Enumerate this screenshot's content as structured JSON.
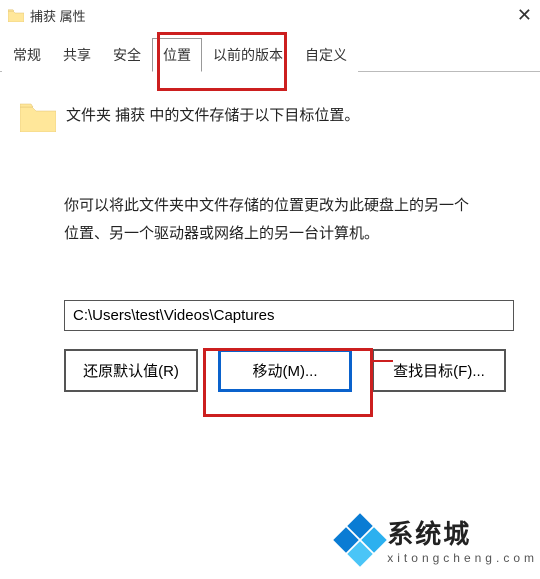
{
  "window": {
    "title": "捕获 属性"
  },
  "tabs": {
    "t0": "常规",
    "t1": "共享",
    "t2": "安全",
    "t3": "位置",
    "t4": "以前的版本",
    "t5": "自定义"
  },
  "content": {
    "line1": "文件夹 捕获 中的文件存储于以下目标位置。",
    "line2": "你可以将此文件夹中文件存储的位置更改为此硬盘上的另一个位置、另一个驱动器或网络上的另一台计算机。",
    "path": "C:\\Users\\test\\Videos\\Captures"
  },
  "buttons": {
    "restore": "还原默认值(R)",
    "move": "移动(M)...",
    "find": "查找目标(F)..."
  },
  "watermark": {
    "main": "系统城",
    "sub": "xitongcheng.com"
  }
}
